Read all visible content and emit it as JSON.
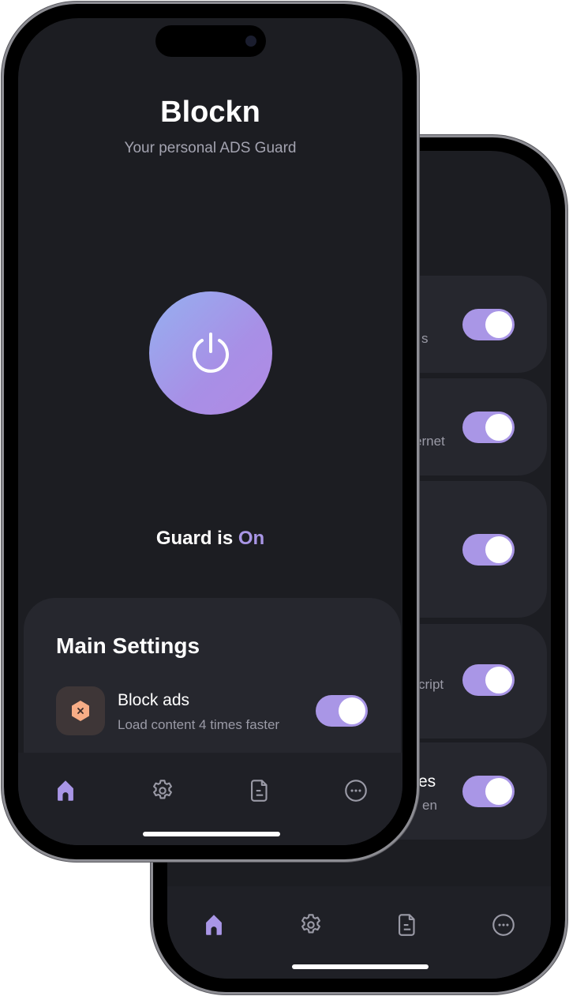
{
  "colors": {
    "accent": "#a996e6",
    "screen_bg": "#1c1d22",
    "card_bg": "#26272e",
    "icon_bg": "#3e3637",
    "icon_fg": "#f7ad86"
  },
  "back_phone": {
    "fragments": [
      {
        "text": "s",
        "toggle_on": true
      },
      {
        "text": "ernet",
        "toggle_on": true
      },
      {
        "text": "",
        "toggle_on": true
      },
      {
        "text": "cript",
        "toggle_on": true
      },
      {
        "title_text": "es",
        "text": "en",
        "toggle_on": true
      }
    ],
    "nav": [
      "home-icon",
      "gear-icon",
      "document-icon",
      "more-icon"
    ],
    "active_nav": "home"
  },
  "front_phone": {
    "app_title": "Blockn",
    "subtitle": "Your personal ADS Guard",
    "power_icon": "power-icon",
    "status_prefix": "Guard is",
    "status_value": "On",
    "settings": {
      "title": "Main Settings",
      "items": [
        {
          "icon": "block-hexagon-icon",
          "label": "Block ads",
          "description": "Load content 4 times faster",
          "enabled": true
        }
      ]
    },
    "nav": [
      "home-icon",
      "gear-icon",
      "document-icon",
      "more-icon"
    ],
    "active_nav": "home"
  }
}
